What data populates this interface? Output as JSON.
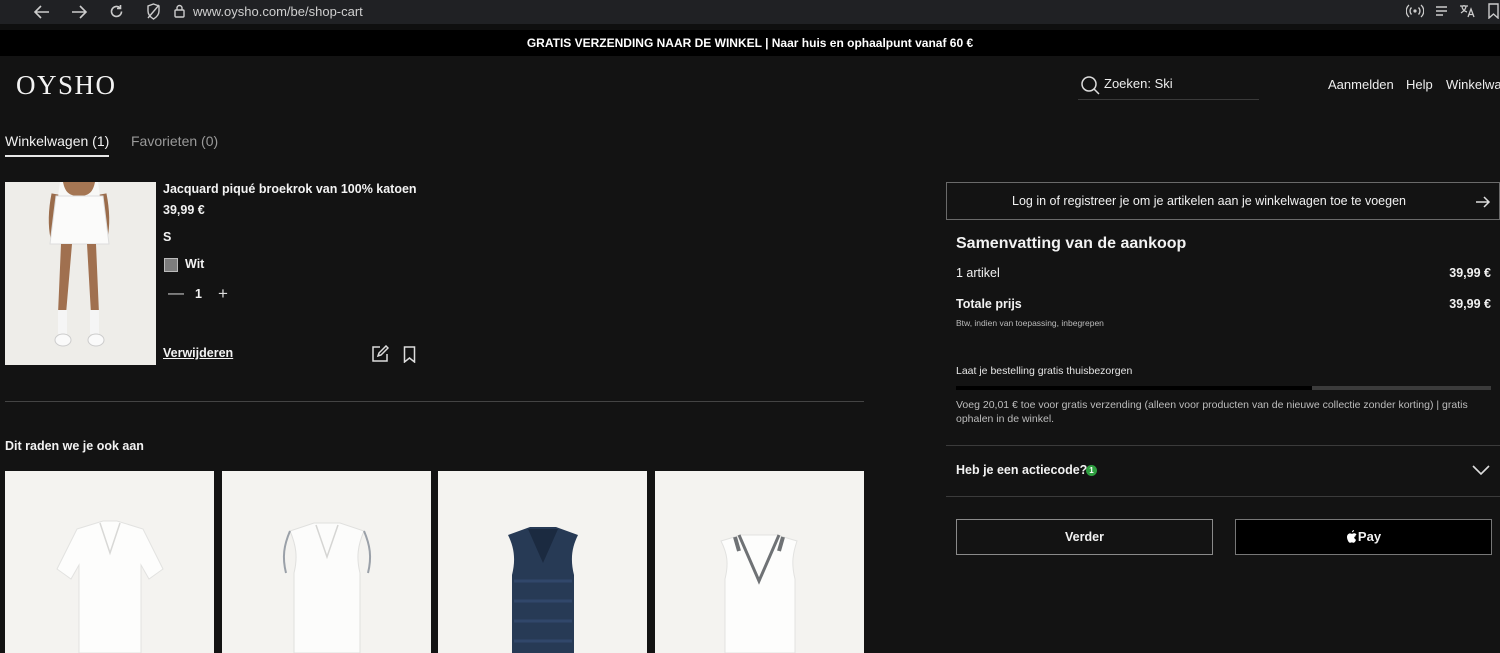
{
  "browser": {
    "url": "www.oysho.com/be/shop-cart"
  },
  "promo_banner": "GRATIS VERZENDING NAAR DE WINKEL | Naar huis en ophaalpunt vanaf 60 €",
  "header": {
    "logo": "OYSHO",
    "search_text": "Zoeken: Ski",
    "nav": [
      "Aanmelden",
      "Help",
      "Winkelwa"
    ]
  },
  "tabs": {
    "cart": "Winkelwagen (1)",
    "favorites": "Favorieten (0)"
  },
  "cart_item": {
    "name": "Jacquard piqué broekrok van 100% katoen",
    "price": "39,99 €",
    "size": "S",
    "color": "Wit",
    "quantity": "1",
    "remove_label": "Verwijderen"
  },
  "recommendations": {
    "title": "Dit raden we je ook aan"
  },
  "summary": {
    "login_prompt": "Log in of registreer je om je artikelen aan je winkelwagen toe te voegen",
    "title": "Samenvatting van de aankoop",
    "items_label": "1 artikel",
    "items_value": "39,99 €",
    "total_label": "Totale prijs",
    "total_value": "39,99 €",
    "tax_note": "Btw, indien van toepassing, inbegrepen",
    "shipping_title": "Laat je bestelling gratis thuisbezorgen",
    "shipping_progress": 0.665,
    "shipping_text": "Voeg 20,01 € toe voor gratis verzending (alleen voor producten van de nieuwe collectie zonder korting) | gratis ophalen in de winkel.",
    "promo_question": "Heb je een actiecode?",
    "promo_badge": "1",
    "next_button": "Verder",
    "pay_button": "Pay"
  },
  "colors": {
    "background": "#131313",
    "promo_badge": "#2e9e3f"
  }
}
